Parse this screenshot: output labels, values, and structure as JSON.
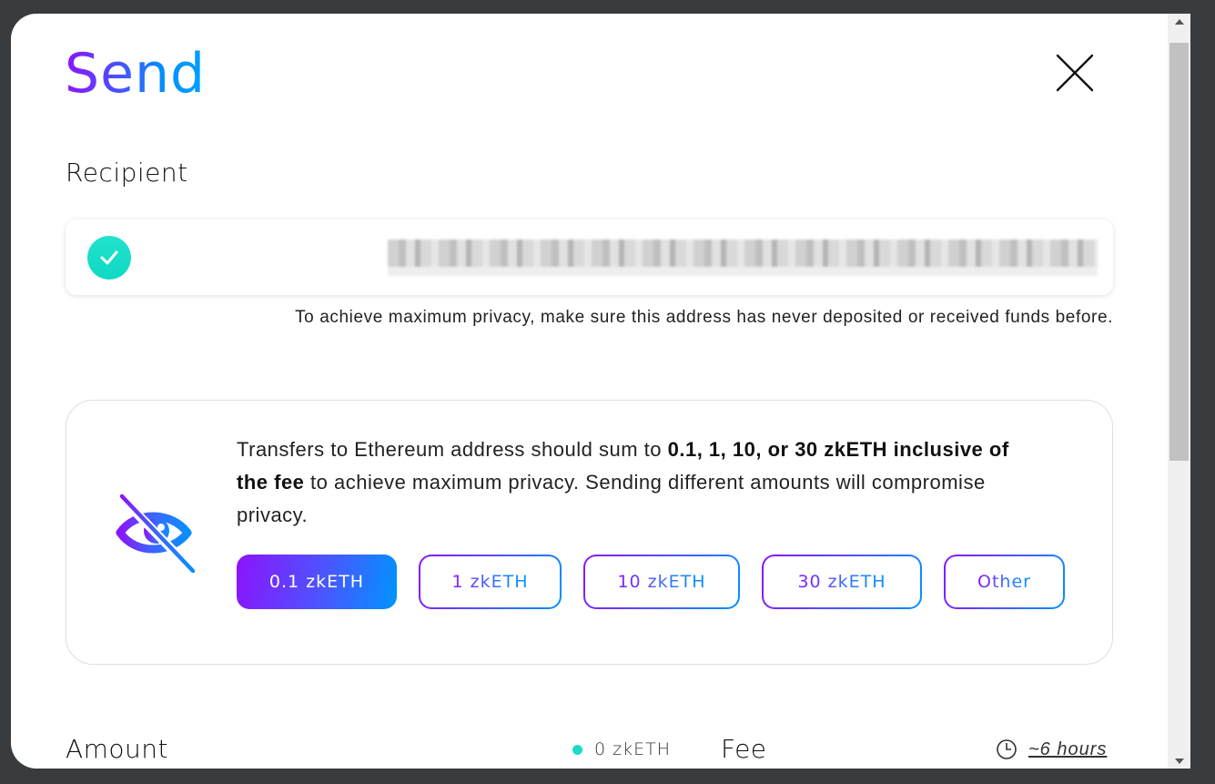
{
  "modal": {
    "title": "Send",
    "close_icon": "close-icon"
  },
  "recipient": {
    "label": "Recipient",
    "status_icon": "check-circle-icon",
    "address_value": "[redacted address]",
    "hint": "To achieve maximum privacy, make sure this address has never deposited or received funds before."
  },
  "warning": {
    "icon": "eye-slash-icon",
    "text_part1": "Transfers to Ethereum address should sum to ",
    "text_bold": "0.1, 1, 10, or 30 zkETH inclusive of the fee",
    "text_part2": " to achieve maximum privacy. Sending different amounts will compromise privacy.",
    "options": [
      {
        "label": "0.1 zkETH",
        "selected": true
      },
      {
        "label": "1 zkETH",
        "selected": false
      },
      {
        "label": "10 zkETH",
        "selected": false
      },
      {
        "label": "30 zkETH",
        "selected": false
      },
      {
        "label": "Other",
        "selected": false
      }
    ]
  },
  "amount": {
    "label": "Amount",
    "balance": "0 zkETH",
    "balance_dot_color": "#1ddbc4"
  },
  "fee": {
    "label": "Fee",
    "eta_icon": "clock-icon",
    "eta": "~6 hours"
  },
  "colors": {
    "gradient_start": "#8c14fc",
    "gradient_end": "#0094ff",
    "success": "#1ddbc4"
  }
}
